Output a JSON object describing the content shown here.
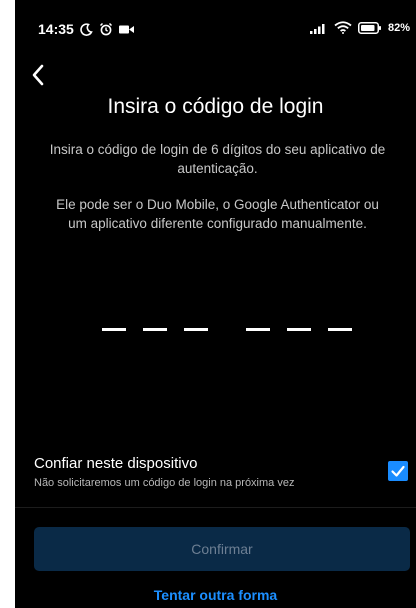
{
  "status_bar": {
    "time": "14:35",
    "battery": "82"
  },
  "screen": {
    "title": "Insira o código de login",
    "description_1": "Insira o código de login de 6 dígitos do seu aplicativo de autenticação.",
    "description_2": "Ele pode ser o Duo Mobile, o Google Authenticator ou um aplicativo diferente configurado manualmente.",
    "code_slots": 6
  },
  "trust_device": {
    "label": "Confiar neste dispositivo",
    "sublabel": "Não solicitaremos um código de login na próxima vez",
    "checked": true
  },
  "actions": {
    "confirm_label": "Confirmar",
    "alternate_label": "Tentar outra forma"
  },
  "icons": {
    "status_left": [
      "moon-icon",
      "alarm-icon",
      "video-icon"
    ],
    "status_right": [
      "signal-icon",
      "wifi-icon",
      "battery-icon"
    ],
    "back": "back-arrow-icon",
    "checkbox": "check-icon"
  },
  "colors": {
    "background": "#000000",
    "accent": "#1a8cff",
    "button_disabled_bg": "#0a2a47",
    "button_disabled_text": "#6d7f93"
  }
}
